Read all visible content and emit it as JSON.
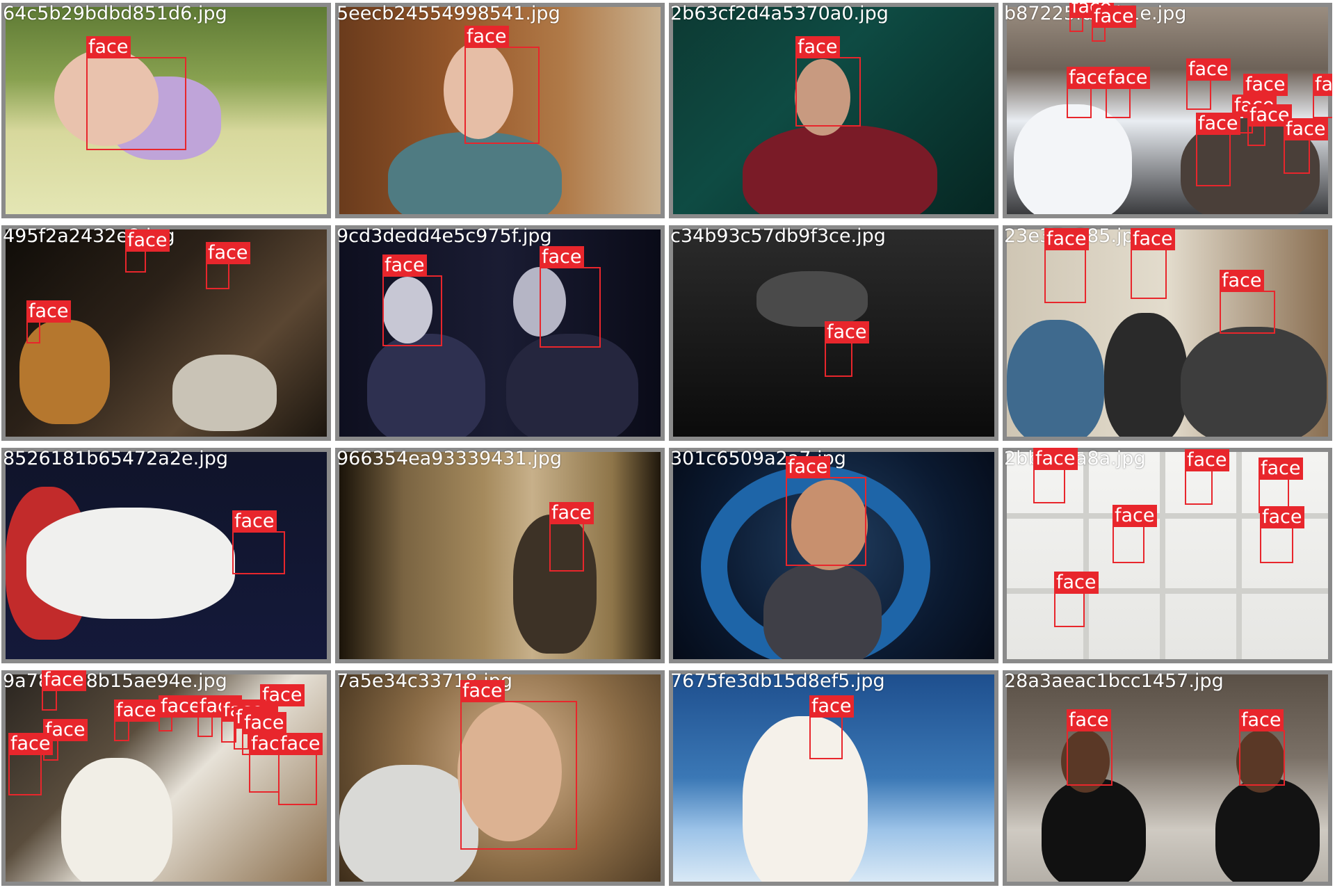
{
  "label_color": "#e8262c",
  "tile_border_color": "#8a8a8a",
  "tiles": [
    {
      "filename": "64c5b29bdbd851d6.jpg",
      "labels": [
        "face"
      ]
    },
    {
      "filename": "5eecb24554998541.jpg",
      "labels": [
        "face"
      ]
    },
    {
      "filename": "2b63cf2d4a5370a0.jpg",
      "labels": [
        "face"
      ]
    },
    {
      "filename": "b87225fa1cb1e.jpg",
      "labels": [
        "face",
        "face",
        "face",
        "face",
        "face",
        "face",
        "face",
        "face",
        "face",
        "face",
        "face"
      ]
    },
    {
      "filename": "495f2a2432e8.jpg",
      "labels": [
        "face",
        "face",
        "face"
      ]
    },
    {
      "filename": "9cd3dedd4e5c975f.jpg",
      "labels": [
        "face",
        "face"
      ]
    },
    {
      "filename": "c34b93c57db9f3ce.jpg",
      "labels": [
        "face"
      ]
    },
    {
      "filename": "23e37e385.jpg",
      "labels": [
        "face",
        "face",
        "face"
      ]
    },
    {
      "filename": "8526181b65472a2e.jpg",
      "labels": [
        "face"
      ]
    },
    {
      "filename": "966354ea93339431.jpg",
      "labels": [
        "face"
      ]
    },
    {
      "filename": "301c6509a2a7.jpg",
      "labels": [
        "face"
      ]
    },
    {
      "filename": "2bb05ba8a.jpg",
      "labels": [
        "face",
        "face",
        "face",
        "face",
        "face",
        "face"
      ]
    },
    {
      "filename": "9a789d68b15ae94e.jpg",
      "labels": [
        "face",
        "face",
        "face",
        "face",
        "face",
        "face",
        "face",
        "face",
        "face",
        "face",
        "face",
        "face"
      ]
    },
    {
      "filename": "7a5e34c33718.jpg",
      "labels": [
        "face"
      ]
    },
    {
      "filename": "7675fe3db15d8ef5.jpg",
      "labels": [
        "face"
      ]
    },
    {
      "filename": "28a3aeac1bcc1457.jpg",
      "labels": [
        "face",
        "face"
      ]
    }
  ]
}
